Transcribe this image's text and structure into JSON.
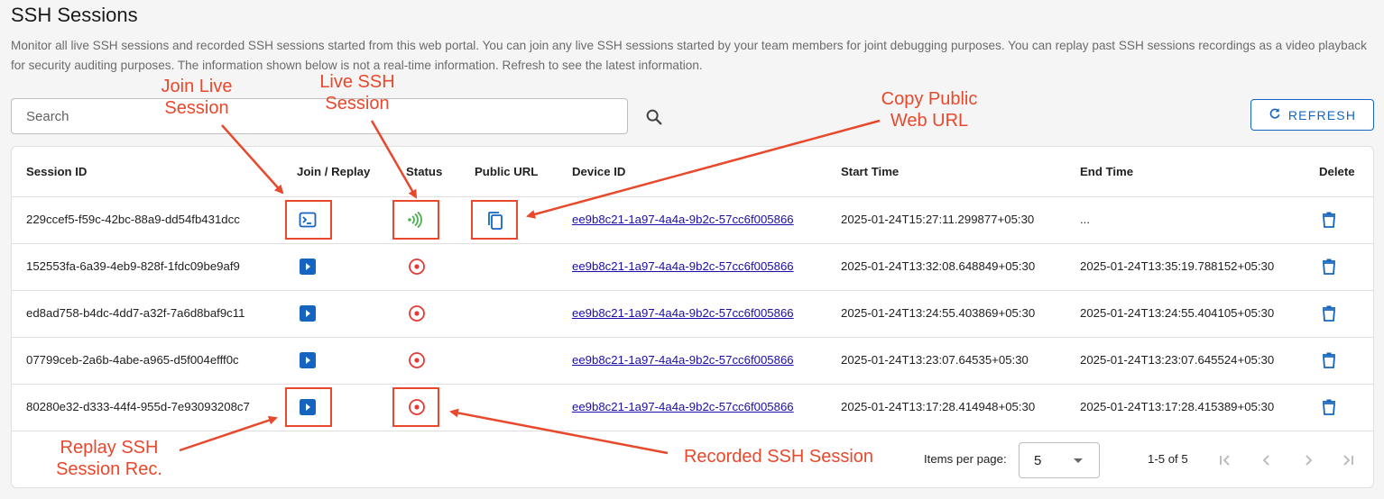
{
  "page": {
    "title": "SSH Sessions",
    "description": "Monitor all live SSH sessions and recorded SSH sessions started from this web portal. You can join any live SSH sessions started by your team members for joint debugging purposes. You can replay past SSH sessions recordings as a video playback for security auditing purposes. The information shown below is not a real-time information. Refresh to see the latest information."
  },
  "search": {
    "placeholder": "Search",
    "value": "",
    "icon": "search-icon"
  },
  "refresh_button": {
    "label": "REFRESH",
    "icon": "refresh-icon"
  },
  "table": {
    "headers": {
      "session_id": "Session ID",
      "join_replay": "Join / Replay",
      "status": "Status",
      "public_url": "Public URL",
      "device_id": "Device ID",
      "start_time": "Start Time",
      "end_time": "End Time",
      "delete": "Delete"
    },
    "rows": [
      {
        "session_id": "229ccef5-f59c-42bc-88a9-dd54fb431dcc",
        "action": "join-terminal-icon",
        "status": "live-signal-icon",
        "public_url": "copy-icon",
        "device_id": "ee9b8c21-1a97-4a4a-9b2c-57cc6f005866",
        "start_time": "2025-01-24T15:27:11.299877+05:30",
        "end_time": "..."
      },
      {
        "session_id": "152553fa-6a39-4eb9-828f-1fdc09be9af9",
        "action": "replay-icon",
        "status": "recorded-icon",
        "public_url": "",
        "device_id": "ee9b8c21-1a97-4a4a-9b2c-57cc6f005866",
        "start_time": "2025-01-24T13:32:08.648849+05:30",
        "end_time": "2025-01-24T13:35:19.788152+05:30"
      },
      {
        "session_id": "ed8ad758-b4dc-4dd7-a32f-7a6d8baf9c11",
        "action": "replay-icon",
        "status": "recorded-icon",
        "public_url": "",
        "device_id": "ee9b8c21-1a97-4a4a-9b2c-57cc6f005866",
        "start_time": "2025-01-24T13:24:55.403869+05:30",
        "end_time": "2025-01-24T13:24:55.404105+05:30"
      },
      {
        "session_id": "07799ceb-2a6b-4abe-a965-d5f004efff0c",
        "action": "replay-icon",
        "status": "recorded-icon",
        "public_url": "",
        "device_id": "ee9b8c21-1a97-4a4a-9b2c-57cc6f005866",
        "start_time": "2025-01-24T13:23:07.64535+05:30",
        "end_time": "2025-01-24T13:23:07.645524+05:30"
      },
      {
        "session_id": "80280e32-d333-44f4-955d-7e93093208c7",
        "action": "replay-icon",
        "status": "recorded-icon",
        "public_url": "",
        "device_id": "ee9b8c21-1a97-4a4a-9b2c-57cc6f005866",
        "start_time": "2025-01-24T13:17:28.414948+05:30",
        "end_time": "2025-01-24T13:17:28.415389+05:30"
      }
    ]
  },
  "pagination": {
    "items_per_page_label": "Items per page:",
    "items_per_page": "5",
    "range": "1-5 of 5",
    "icons": [
      "first-page-icon",
      "prev-page-icon",
      "next-page-icon",
      "last-page-icon"
    ]
  },
  "annotations": {
    "join_live": "Join Live\nSession",
    "live_ssh": "Live SSH\nSession",
    "copy_url": "Copy Public\nWeb URL",
    "replay": "Replay SSH\nSession Rec.",
    "recorded": "Recorded SSH Session"
  },
  "colors": {
    "accent": "#1565c0",
    "live": "#4caf50",
    "recorded": "#e53935",
    "annotation": "#e8482c",
    "link": "#1a0dab"
  }
}
